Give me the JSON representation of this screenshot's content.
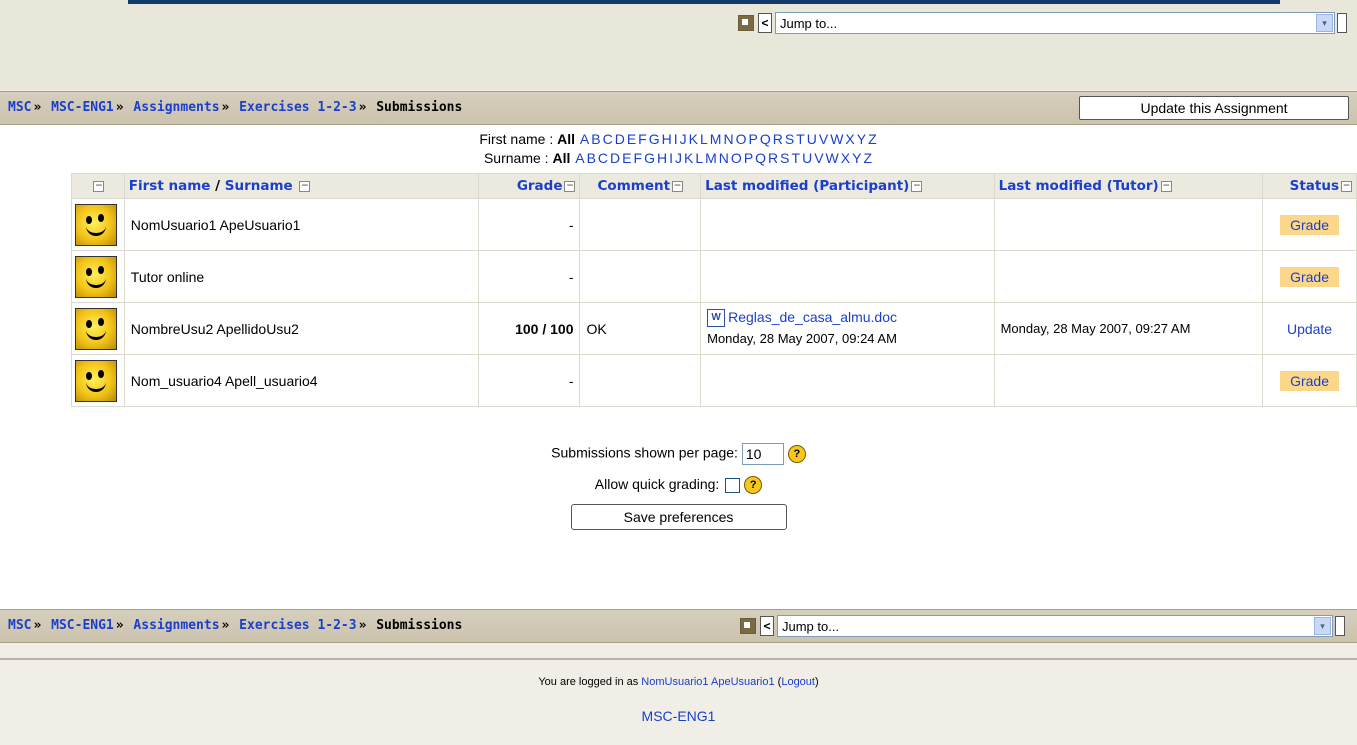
{
  "jump_menu": {
    "placeholder": "Jump to...",
    "prev": "<",
    "dropdown_arrow": "▾"
  },
  "breadcrumb": {
    "items": [
      "MSC",
      "MSC-ENG1",
      "Assignments",
      "Exercises 1-2-3"
    ],
    "current": "Submissions",
    "separator": "»"
  },
  "update_button": "Update this Assignment",
  "filters": {
    "first_name_label": "First name : ",
    "surname_label": "Surname : ",
    "all": "All",
    "letters": [
      "A",
      "B",
      "C",
      "D",
      "E",
      "F",
      "G",
      "H",
      "I",
      "J",
      "K",
      "L",
      "M",
      "N",
      "O",
      "P",
      "Q",
      "R",
      "S",
      "T",
      "U",
      "V",
      "W",
      "X",
      "Y",
      "Z"
    ]
  },
  "table": {
    "headers": {
      "first_name": "First name",
      "slash": " / ",
      "surname": "Surname",
      "grade": "Grade",
      "comment": "Comment",
      "last_modified_participant": "Last modified (Participant)",
      "last_modified_tutor": "Last modified (Tutor)",
      "status": "Status"
    },
    "rows": [
      {
        "name": "NomUsuario1 ApeUsuario1",
        "grade": "-",
        "comment": "",
        "file": "",
        "participant_date": "",
        "tutor_date": "",
        "status": "Grade"
      },
      {
        "name": "Tutor online",
        "grade": "-",
        "comment": "",
        "file": "",
        "participant_date": "",
        "tutor_date": "",
        "status": "Grade"
      },
      {
        "name": "NombreUsu2 ApellidoUsu2",
        "grade": "100",
        "grade_max": " / 100",
        "comment": "OK",
        "file": "Reglas_de_casa_almu.doc",
        "participant_date": "Monday, 28 May 2007, 09:24 AM",
        "tutor_date": "Monday, 28 May 2007, 09:27 AM",
        "status": "Update"
      },
      {
        "name": "Nom_usuario4 Apell_usuario4",
        "grade": "-",
        "comment": "",
        "file": "",
        "participant_date": "",
        "tutor_date": "",
        "status": "Grade"
      }
    ]
  },
  "preferences": {
    "per_page_label": "Submissions shown per page:",
    "per_page_value": "10",
    "quick_grading_label": "Allow quick grading:",
    "save_button": "Save preferences",
    "help": "?"
  },
  "footer": {
    "logged_in_prefix": "You are logged in as ",
    "user": "NomUsuario1 ApeUsuario1",
    "logout": "Logout",
    "course": "MSC-ENG1"
  },
  "colors": {
    "link": "#1a3fcc",
    "grade_tag": "#fcd78a",
    "navbar": "#d6cfbd"
  }
}
